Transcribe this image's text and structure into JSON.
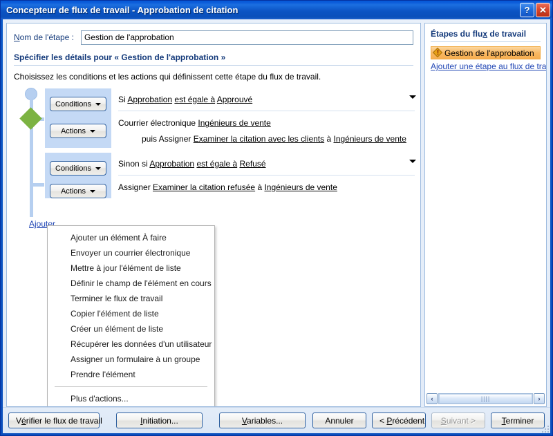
{
  "window": {
    "title": "Concepteur de flux de travail - Approbation de citation",
    "help_button": "?",
    "close_button": "✕"
  },
  "form": {
    "name_label_prefix": "N",
    "name_label_rest": "om de l'étape :",
    "name_value": "Gestion de l'approbation",
    "section_title": "Spécifier les détails pour « Gestion de l'approbation »",
    "section_desc": "Choisissez les conditions et les actions qui définissent cette étape du flux de travail."
  },
  "branches": [
    {
      "conditions_button": "Conditions",
      "actions_button": "Actions",
      "condition_prefix": "Si ",
      "condition_field": "Approbation",
      "condition_operator": "est égale à",
      "condition_value": "Approuvé",
      "action_line1_prefix": "Courrier électronique ",
      "action_line1_target": "Ingénieurs de vente",
      "action_line2_prefix": "puis Assigner ",
      "action_line2_task": "Examiner la citation avec les clients",
      "action_line2_mid": " à ",
      "action_line2_target": "Ingénieurs de vente"
    },
    {
      "conditions_button": "Conditions",
      "actions_button": "Actions",
      "condition_prefix": "Sinon si ",
      "condition_field": "Approbation",
      "condition_operator": "est égale à",
      "condition_value": "Refusé",
      "action_line1_prefix": "Assigner ",
      "action_line1_task": "Examiner la citation refusée",
      "action_line1_mid": " à ",
      "action_line1_target": "Ingénieurs de vente"
    }
  ],
  "add_branch_link": "Ajouter",
  "actions_menu": {
    "items": [
      "Ajouter un élément À faire",
      "Envoyer un courrier électronique",
      "Mettre à jour l'élément de liste",
      "Définir le champ de l'élément en cours",
      "Terminer le flux de travail",
      "Copier l'élément de liste",
      "Créer un élément de liste",
      "Récupérer les données d'un utilisateur",
      "Assigner un formulaire à un groupe",
      "Prendre l'élément"
    ],
    "more": "Plus d'actions..."
  },
  "sidebar": {
    "title_prefix": "Étapes du flu",
    "title_accel": "x",
    "title_suffix": " de travail",
    "step_label": "Gestion de l'approbation",
    "step_icon": "warning-icon",
    "add_step_link": "Ajouter une étape au flux de travail",
    "scroll_left": "‹",
    "scroll_right": "›",
    "scroll_thumb_grip": "||||"
  },
  "footer": {
    "verify_prefix": "V",
    "verify_accel": "é",
    "verify_suffix": "rifier le flux de travail",
    "initiation_accel": "I",
    "initiation_suffix": "nitiation...",
    "variables_accel": "V",
    "variables_suffix": "ariables...",
    "cancel": "Annuler",
    "previous_prefix": "< ",
    "previous_accel": "P",
    "previous_suffix": "récédent",
    "next_prefix": "",
    "next_accel": "S",
    "next_suffix": "uivant >",
    "next_disabled": true,
    "finish_accel": "T",
    "finish_suffix": "erminer"
  },
  "colors": {
    "titlebar_blue": "#0a58c8",
    "accent_green": "#7cb342",
    "band_blue": "#c4d9f5",
    "selected_orange": "#f8b863",
    "link_blue": "#2247b5",
    "heading_navy": "#13397a"
  }
}
